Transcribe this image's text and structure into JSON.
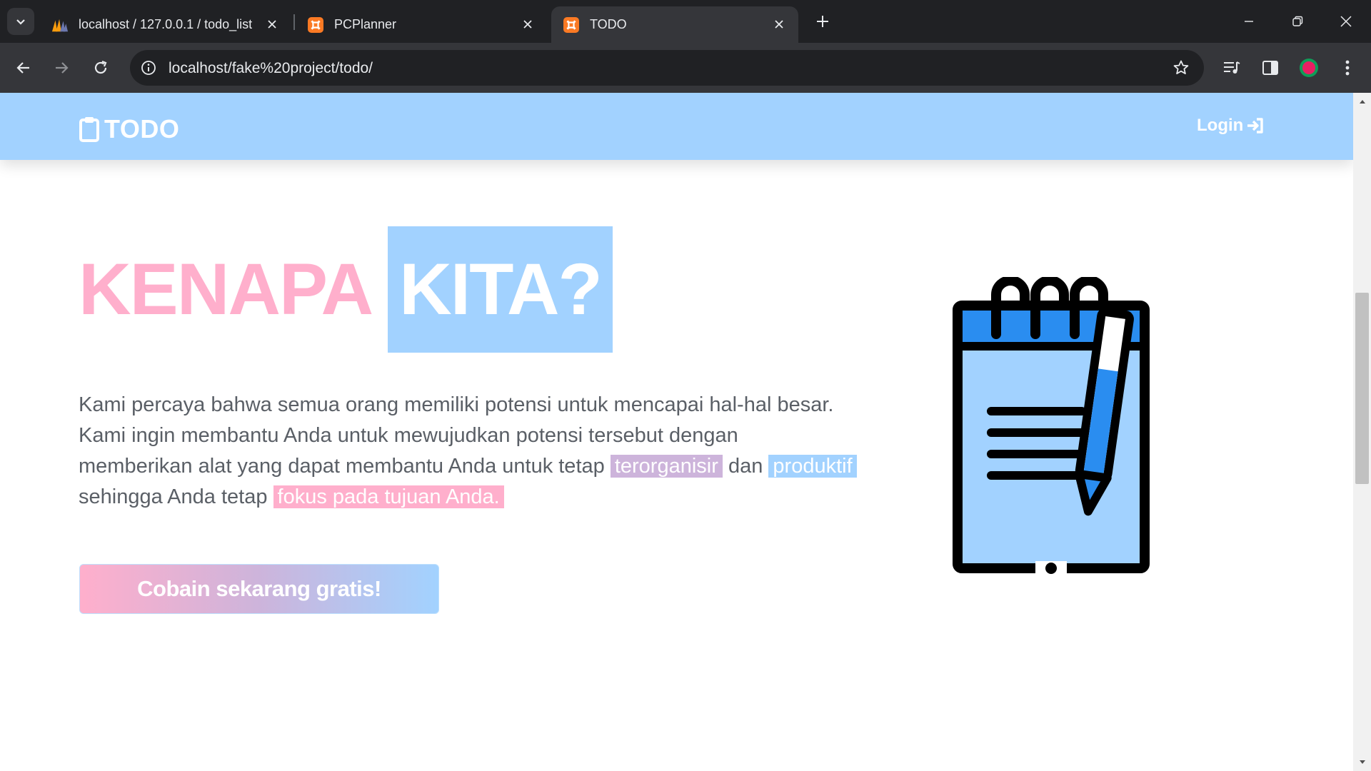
{
  "browser": {
    "tabs": [
      {
        "title": "localhost / 127.0.0.1 / todo_list",
        "favicon": "phpmyadmin-icon",
        "active": false
      },
      {
        "title": "PCPlanner",
        "favicon": "xampp-icon",
        "active": false
      },
      {
        "title": "TODO",
        "favicon": "xampp-icon",
        "active": true
      }
    ],
    "url": "localhost/fake%20project/todo/"
  },
  "navbar": {
    "brand": "TODO",
    "brand_icon": "clipboard-icon",
    "login": "Login",
    "login_icon": "sign-in-icon"
  },
  "hero": {
    "title_part1": "KENAPA",
    "title_part2": "KITA?",
    "para_1": "Kami percaya bahwa semua orang memiliki potensi untuk mencapai hal-hal besar. Kami ingin membantu Anda untuk mewujudkan potensi tersebut dengan memberikan alat yang dapat membantu Anda untuk tetap",
    "hl_1": "terorganisir",
    "para_2": "dan",
    "hl_2": "produktif",
    "para_3": "sehingga Anda tetap",
    "hl_3": "fokus pada tujuan Anda.",
    "cta": "Cobain sekarang gratis!",
    "illustration": "notepad-pen-icon"
  },
  "colors": {
    "pink": "#ffafcc",
    "blue": "#a2d2ff",
    "purple": "#cdb4db",
    "browser_dark": "#202124",
    "browser_mid": "#35363a"
  }
}
